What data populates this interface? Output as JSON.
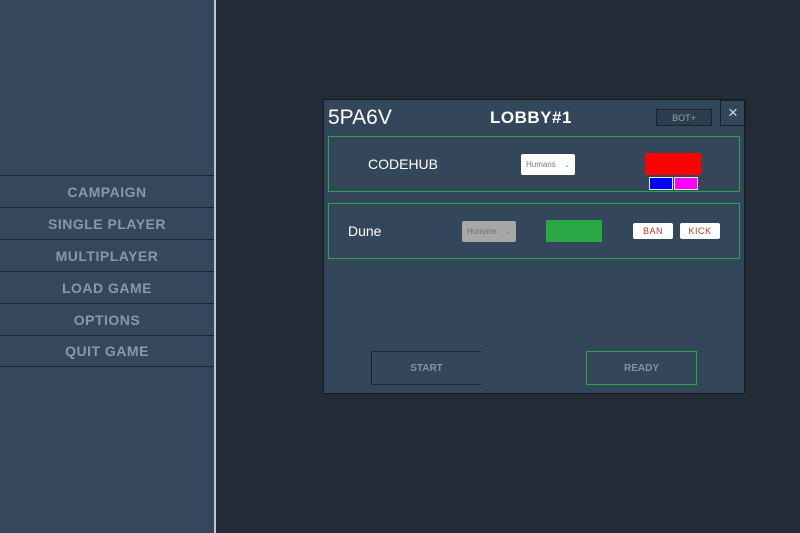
{
  "menu": {
    "items": [
      {
        "label": "CAMPAIGN"
      },
      {
        "label": "SINGLE PLAYER"
      },
      {
        "label": "MULTIPLAYER"
      },
      {
        "label": "LOAD GAME"
      },
      {
        "label": "OPTIONS"
      },
      {
        "label": "QUIT GAME"
      }
    ]
  },
  "lobby": {
    "code": "5PA6V",
    "title": "LOBBY#1",
    "bot_button": "BOT+",
    "close_icon": "×",
    "players": [
      {
        "name": "CODEHUB",
        "faction": "Humans",
        "color": "#ff0000",
        "color_options": [
          "#0000ff",
          "#ff00ff"
        ]
      },
      {
        "name": "Dune",
        "faction": "Humans",
        "color": "#28a745",
        "ban_label": "BAN",
        "kick_label": "KICK"
      }
    ],
    "start_label": "START",
    "ready_label": "READY"
  },
  "colors": {
    "background": "#222b36",
    "sidebar": "#34475b",
    "modal": "#33465a",
    "accent_green": "#28a745",
    "danger_text": "#c0392b"
  }
}
